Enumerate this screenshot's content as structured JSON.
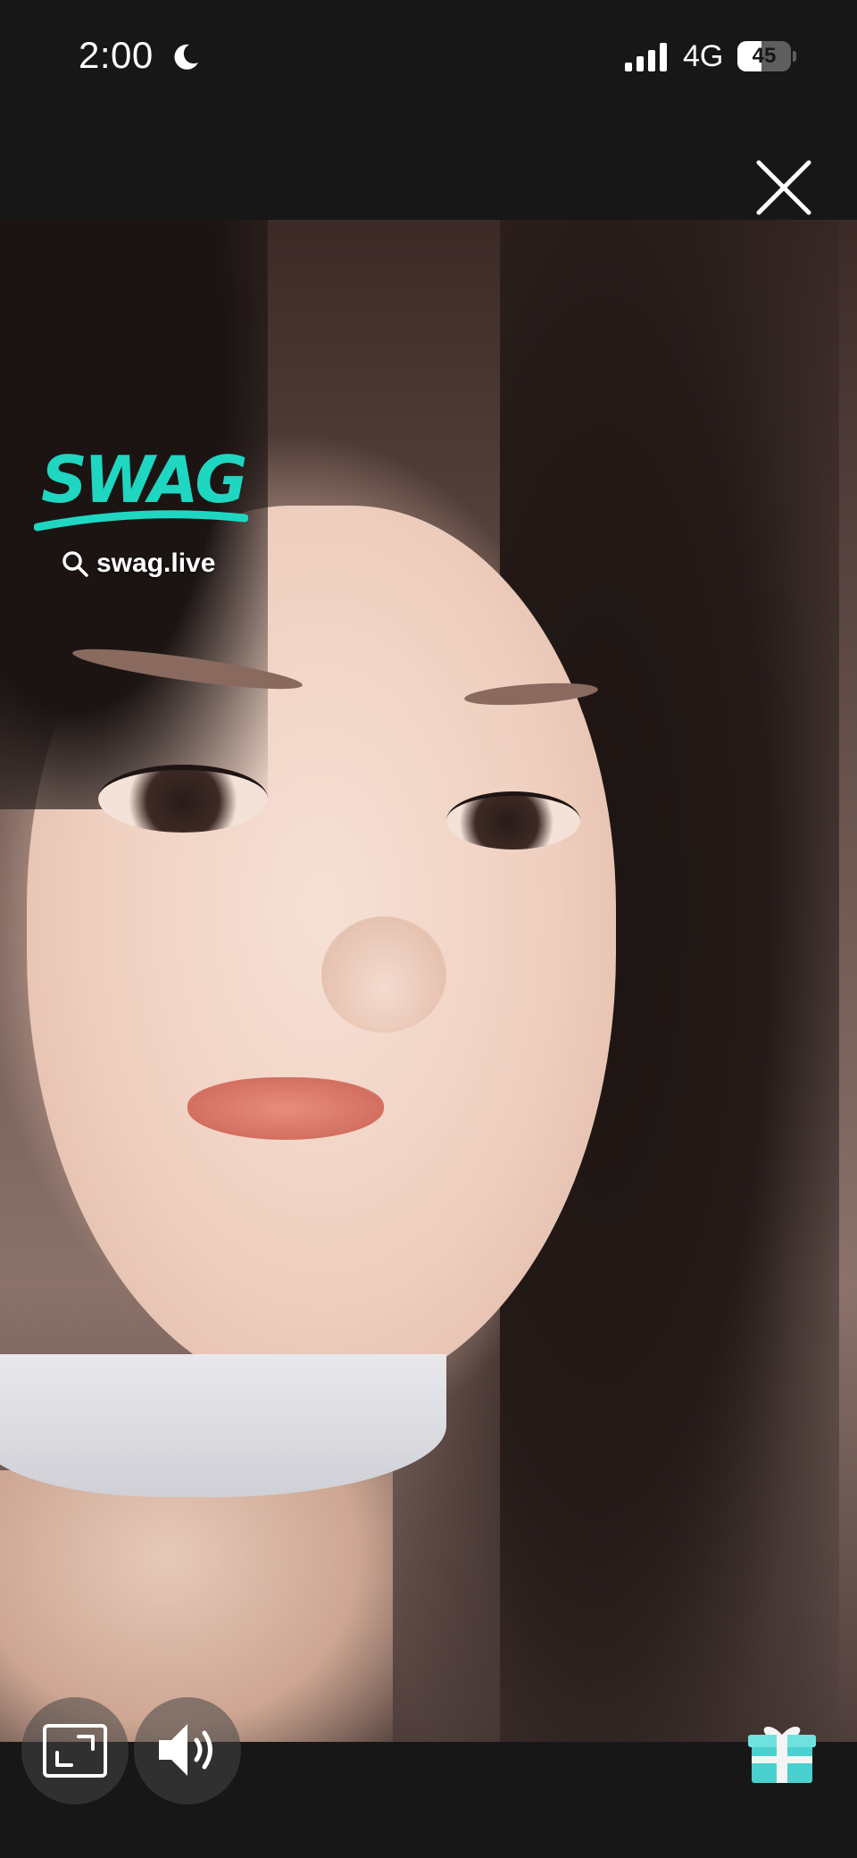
{
  "status_bar": {
    "time": "2:00",
    "network": "4G",
    "battery_percent": "45",
    "battery_level": 0.45,
    "icons": [
      "moon-icon",
      "signal-bars-icon",
      "battery-icon"
    ]
  },
  "overlay": {
    "close_icon": "close-icon"
  },
  "video": {
    "watermark": {
      "logo_text": "SWAG",
      "url": "swag.live",
      "url_icon": "search-icon"
    }
  },
  "controls": {
    "fullscreen_icon": "fullscreen-icon",
    "volume_icon": "speaker-volume-icon",
    "gift_icon": "gift-icon"
  },
  "colors": {
    "background": "#171717",
    "brand_teal": "#1fd6c1",
    "gift_teal": "#49d1cf",
    "text": "#ffffff"
  }
}
